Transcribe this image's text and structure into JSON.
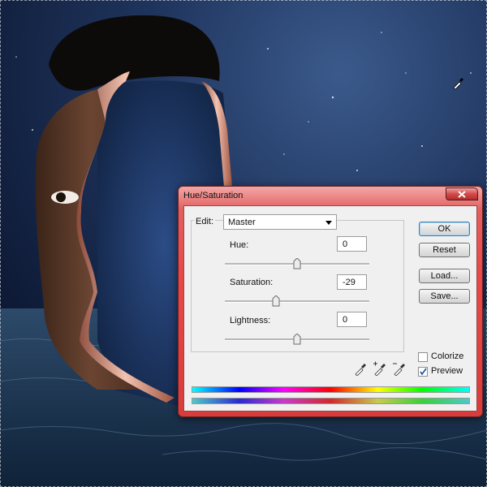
{
  "dialog": {
    "title": "Hue/Saturation",
    "edit_label": "Edit:",
    "edit_value": "Master",
    "sliders": [
      {
        "label": "Hue:",
        "value": "0",
        "position": 0.5
      },
      {
        "label": "Saturation:",
        "value": "-29",
        "position": 0.355
      },
      {
        "label": "Lightness:",
        "value": "0",
        "position": 0.5
      }
    ],
    "buttons": {
      "ok": "OK",
      "cancel": "Reset",
      "load": "Load...",
      "save": "Save..."
    },
    "options": {
      "colorize_label": "Colorize",
      "colorize_checked": false,
      "preview_label": "Preview",
      "preview_checked": true
    }
  },
  "colors": {
    "dialog_frame": "#e84848",
    "sky": "#20365f",
    "sea": "#1c3350"
  },
  "icons": [
    "close-icon",
    "dropdown-arrow-icon",
    "eyedropper-icon",
    "eyedropper-plus-icon",
    "eyedropper-minus-icon",
    "eyedropper-cursor-icon"
  ]
}
